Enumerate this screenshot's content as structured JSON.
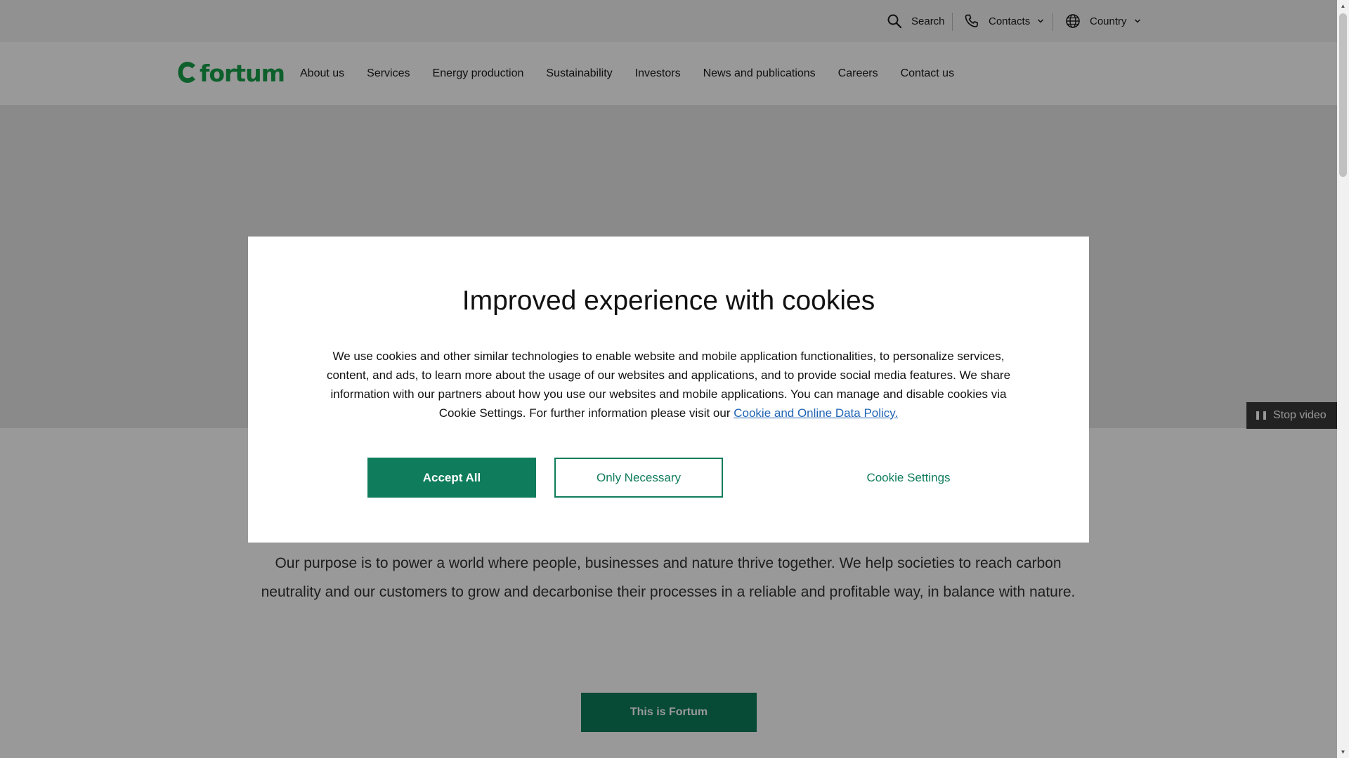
{
  "utility_bar": {
    "search_label": "Search",
    "contacts_label": "Contacts",
    "country_label": "Country"
  },
  "logo": {
    "text": "fortum",
    "color": "#17a04a"
  },
  "nav": {
    "items": [
      {
        "label": "About us"
      },
      {
        "label": "Services"
      },
      {
        "label": "Energy production"
      },
      {
        "label": "Sustainability"
      },
      {
        "label": "Investors"
      },
      {
        "label": "News and publications"
      },
      {
        "label": "Careers"
      },
      {
        "label": "Contact us"
      }
    ]
  },
  "hero": {
    "stop_video_label": "Stop video"
  },
  "main": {
    "purpose_text": "Our purpose is to power a world where people, businesses and nature thrive together. We help societies to reach carbon neutrality and our customers to grow and decarbonise their processes in a reliable and profitable way, in balance with nature.",
    "cta_label": "This is Fortum"
  },
  "cookie_dialog": {
    "title": "Improved experience with cookies",
    "body": "We use cookies and other similar technologies to enable website and mobile application functionalities, to personalize services, content, and ads, to learn more about the usage of our websites and applications, and to provide social media features. We share information with our partners about how you use our websites and mobile applications. You can manage and disable cookies via Cookie Settings. For further information please visit our ",
    "link_text": "Cookie and Online Data Policy.",
    "accept_all_label": "Accept All",
    "only_necessary_label": "Only Necessary",
    "settings_label": "Cookie Settings"
  },
  "colors": {
    "brand_green": "#0f7c5b",
    "logo_green": "#17a04a",
    "link_blue": "#1f63b3"
  },
  "icons": {
    "search": "search-icon",
    "phone": "phone-icon",
    "globe": "globe-icon",
    "chevron": "chevron-down-icon",
    "pause": "pause-icon"
  }
}
